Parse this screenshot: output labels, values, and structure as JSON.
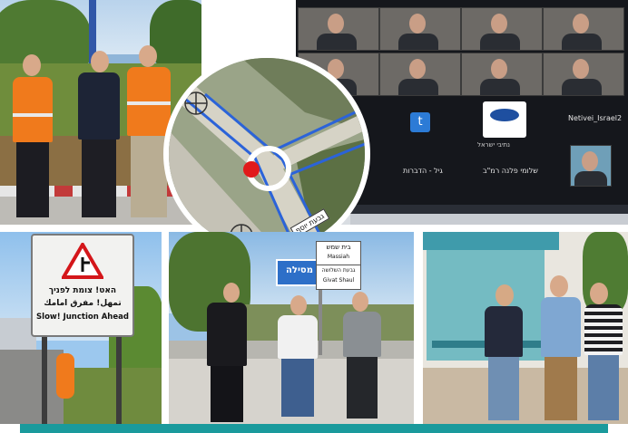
{
  "collage": {
    "road_sign": {
      "line1": "האט! צומת לפניך",
      "line2": "تمهل! مفرق امامك",
      "line3": "Slow! Junction Ahead"
    },
    "map_label": "גבעת יוסף",
    "direction_sign": {
      "main": "מסילה",
      "top1": "בית שמש",
      "top2": "Massiah",
      "bottom1": "גבעת השלושה",
      "bottom2": "Givat Shaul"
    },
    "video_call": {
      "tile_label_1": "t",
      "tile_label_2": "Netivei_Israel2",
      "participant_1": "נתיבי ישראל",
      "participant_2": "גיל - הדברות",
      "participant_3": "שלומי פלנה רמ\"ב"
    },
    "colors": {
      "vest_orange": "#f07a1c",
      "sky_blue": "#9cc8ee",
      "teal_bar": "#1a9a9c",
      "map_marker_red": "#e11a1a"
    }
  }
}
